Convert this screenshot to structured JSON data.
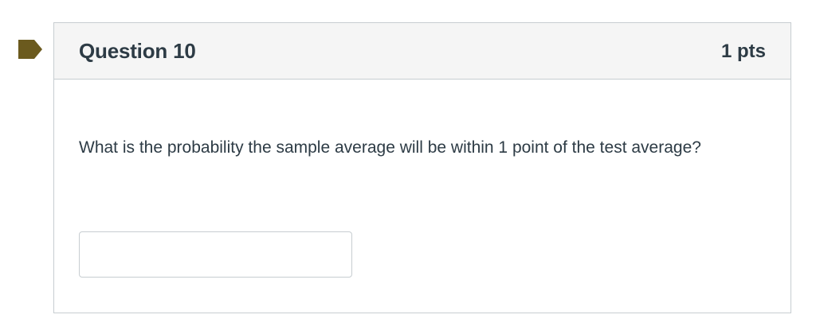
{
  "question": {
    "title": "Question 10",
    "points": "1 pts",
    "text": "What is the probability the sample average will be within 1 point of the test average?",
    "answer_value": "",
    "answer_placeholder": ""
  },
  "flag": {
    "icon": "bookmark-flag-icon",
    "color": "#6b5a1e"
  },
  "colors": {
    "text": "#2d3b45",
    "header_bg": "#f5f5f5",
    "border": "#c7cdd1"
  }
}
